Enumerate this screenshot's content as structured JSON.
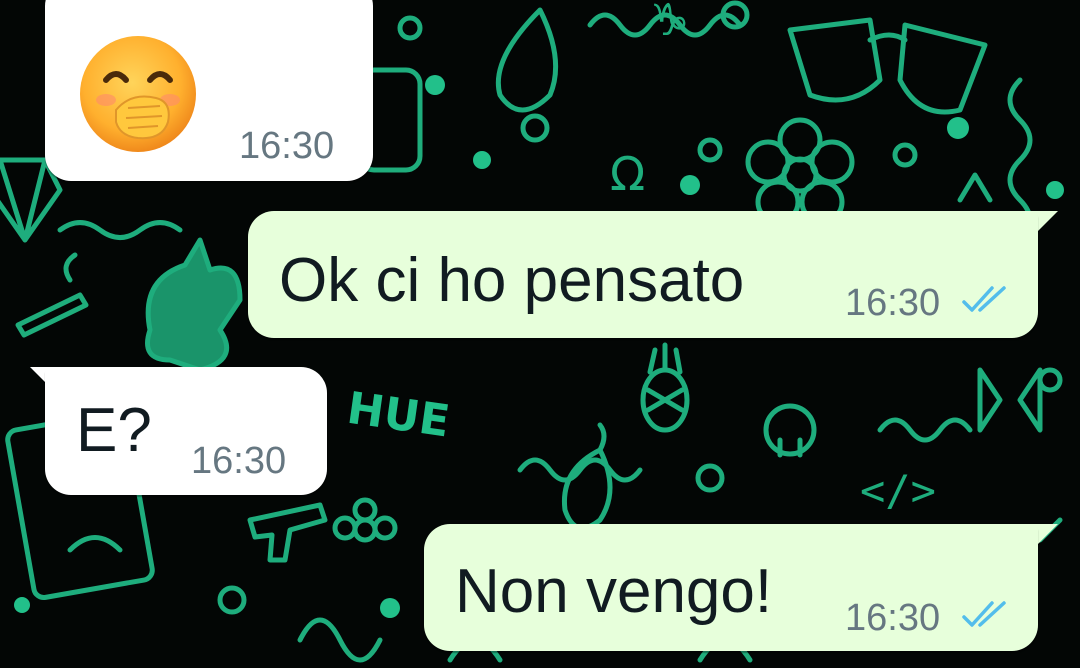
{
  "chat": {
    "messages": [
      {
        "direction": "incoming",
        "type": "emoji",
        "emoji": "🤭",
        "emoji_name": "face-with-hand-over-mouth",
        "time": "16:30"
      },
      {
        "direction": "outgoing",
        "type": "text",
        "text": "Ok ci ho pensato",
        "time": "16:30",
        "status": "read-double-check"
      },
      {
        "direction": "incoming",
        "type": "text",
        "text": "E?",
        "time": "16:30"
      },
      {
        "direction": "outgoing",
        "type": "text",
        "text": "Non vengo!",
        "time": "16:30",
        "status": "read-double-check"
      }
    ]
  },
  "wallpaper": {
    "stamp_text": "HUE",
    "doodle_color": "#22c08a",
    "background_color": "#030605"
  },
  "colors": {
    "incoming_bubble": "#ffffff",
    "outgoing_bubble": "#e7ffdb",
    "text": "#111b21",
    "timestamp": "#667781",
    "read_ticks": "#53bdeb"
  }
}
